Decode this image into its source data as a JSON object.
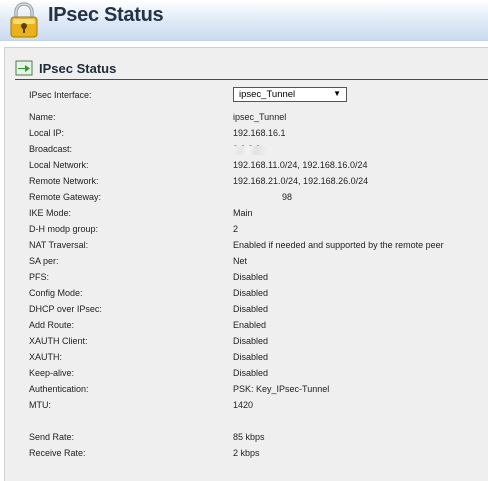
{
  "app": {
    "title": "IPsec Status"
  },
  "panel": {
    "title": "IPsec Status"
  },
  "interface": {
    "label": "IPsec Interface:",
    "selected": "ipsec_Tunnel"
  },
  "rows": [
    {
      "label": "Name:",
      "value": "ipsec_Tunnel"
    },
    {
      "label": "Local IP:",
      "value": "192.168.16.1"
    },
    {
      "label": "Broadcast:",
      "value": "0.0.0.0"
    },
    {
      "label": "Local Network:",
      "value": "192.168.11.0/24, 192.168.16.0/24"
    },
    {
      "label": "Remote Network:",
      "value": "192.168.21.0/24, 192.168.26.0/24"
    },
    {
      "label": "Remote Gateway:",
      "value": "98"
    },
    {
      "label": "IKE Mode:",
      "value": "Main"
    },
    {
      "label": "D-H modp group:",
      "value": "2"
    },
    {
      "label": "NAT Traversal:",
      "value": "Enabled if needed and supported by the remote peer"
    },
    {
      "label": "SA per:",
      "value": "Net"
    },
    {
      "label": "PFS:",
      "value": "Disabled"
    },
    {
      "label": "Config Mode:",
      "value": "Disabled"
    },
    {
      "label": "DHCP over IPsec:",
      "value": "Disabled"
    },
    {
      "label": "Add Route:",
      "value": "Enabled"
    },
    {
      "label": "XAUTH Client:",
      "value": "Disabled"
    },
    {
      "label": "XAUTH:",
      "value": "Disabled"
    },
    {
      "label": "Keep-alive:",
      "value": "Disabled"
    },
    {
      "label": "Authentication:",
      "value": "PSK: Key_IPsec-Tunnel"
    },
    {
      "label": "MTU:",
      "value": "1420"
    }
  ],
  "rates": [
    {
      "label": "Send Rate:",
      "value": "85 kbps"
    },
    {
      "label": "Receive Rate:",
      "value": "2 kbps"
    }
  ],
  "colors": {
    "header_bg": "#cbdcef",
    "panel_bg": "#efefef",
    "title": "#243447"
  },
  "icons": {
    "header": "padlock-icon",
    "panel": "green-arrow-icon",
    "select": "down-triangle"
  }
}
